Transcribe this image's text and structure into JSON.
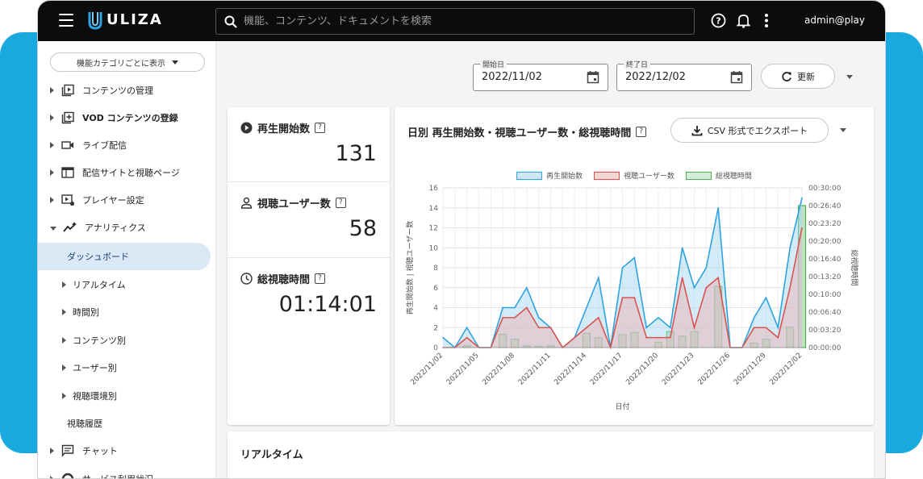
{
  "topbar": {
    "logo_text": "ULIZA",
    "search_placeholder": "機能、コンテンツ、ドキュメントを検索",
    "user": "admin@play"
  },
  "sidebar": {
    "category_select": "機能カテゴリごとに表示",
    "items": [
      {
        "label": "コンテンツの管理",
        "icon": "video-library-icon"
      },
      {
        "label": "VOD コンテンツの登録",
        "icon": "add-box-icon"
      },
      {
        "label": "ライブ配信",
        "icon": "videocam-icon"
      },
      {
        "label": "配信サイトと視聴ページ",
        "icon": "web-icon"
      },
      {
        "label": "プレイヤー設定",
        "icon": "player-settings-icon"
      },
      {
        "label": "アナリティクス",
        "icon": "analytics-icon"
      }
    ],
    "sub_items": [
      {
        "label": "ダッシュボード"
      },
      {
        "label": "リアルタイム"
      },
      {
        "label": "時間別"
      },
      {
        "label": "コンテンツ別"
      },
      {
        "label": "ユーザー別"
      },
      {
        "label": "視聴環境別"
      },
      {
        "label": "視聴履歴"
      }
    ],
    "chat_label": "チャット",
    "service_label": "サービス利用状況"
  },
  "filters": {
    "start_label": "開始日",
    "start_value": "2022/11/02",
    "end_label": "終了日",
    "end_value": "2022/12/02",
    "refresh_label": "更新"
  },
  "stats": [
    {
      "title": "再生開始数",
      "value": "131",
      "icon": "play-circle-icon"
    },
    {
      "title": "視聴ユーザー数",
      "value": "58",
      "icon": "person-icon"
    },
    {
      "title": "総視聴時間",
      "value": "01:14:01",
      "icon": "clock-icon"
    }
  ],
  "chart_panel": {
    "title": "日別 再生開始数・視聴ユーザー数・総視聴時間",
    "export_label": "CSV 形式でエクスポート",
    "export_prefix": "CSV",
    "export_suffix": "形式でエクスポート"
  },
  "colors": {
    "plays": "#2ea3e0",
    "users": "#d9534f",
    "time": "#4caf50"
  },
  "chart_data": {
    "type": "line",
    "title": "",
    "xlabel": "日付",
    "ylabel_left": "再生開始数 | 視聴ユーザー数",
    "ylabel_right": "総視聴時間",
    "ylim": [
      0,
      16
    ],
    "y_ticks": [
      0,
      2,
      4,
      6,
      8,
      10,
      12,
      14,
      16
    ],
    "y2_ticks": [
      "00:00:00",
      "00:03:20",
      "00:06:40",
      "00:10:00",
      "00:13:20",
      "00:16:40",
      "00:20:00",
      "00:23:20",
      "00:26:40",
      "00:30:00"
    ],
    "y2_lim_seconds": [
      0,
      1800
    ],
    "x_tick_labels": [
      "2022/11/02",
      "2022/11/05",
      "2022/11/08",
      "2022/11/11",
      "2022/11/14",
      "2022/11/17",
      "2022/11/20",
      "2022/11/23",
      "2022/11/26",
      "2022/11/29",
      "2022/12/02"
    ],
    "x": [
      "2022/11/02",
      "2022/11/03",
      "2022/11/04",
      "2022/11/05",
      "2022/11/06",
      "2022/11/07",
      "2022/11/08",
      "2022/11/09",
      "2022/11/10",
      "2022/11/11",
      "2022/11/12",
      "2022/11/13",
      "2022/11/14",
      "2022/11/15",
      "2022/11/16",
      "2022/11/17",
      "2022/11/18",
      "2022/11/19",
      "2022/11/20",
      "2022/11/21",
      "2022/11/22",
      "2022/11/23",
      "2022/11/24",
      "2022/11/25",
      "2022/11/26",
      "2022/11/27",
      "2022/11/28",
      "2022/11/29",
      "2022/11/30",
      "2022/12/01",
      "2022/12/02"
    ],
    "series": [
      {
        "name": "再生開始数",
        "kind": "area",
        "axis": "left",
        "values": [
          1,
          0,
          2,
          0,
          0,
          4,
          4,
          6,
          3,
          2,
          0,
          1,
          4,
          7,
          0,
          8,
          9,
          2,
          3,
          2,
          10,
          6,
          8,
          14,
          0,
          0,
          3,
          5,
          2,
          10,
          15
        ]
      },
      {
        "name": "視聴ユーザー数",
        "kind": "area",
        "axis": "left",
        "values": [
          0,
          0,
          1,
          0,
          0,
          3,
          3,
          4,
          2,
          2,
          0,
          1,
          2,
          3,
          0,
          5,
          5,
          1,
          1,
          1,
          7,
          2,
          6,
          7,
          0,
          0,
          2,
          2,
          1,
          6,
          12
        ]
      },
      {
        "name": "総視聴時間",
        "kind": "bar",
        "axis": "right",
        "values": [
          0,
          0,
          20,
          0,
          0,
          150,
          95,
          20,
          15,
          20,
          0,
          0,
          160,
          110,
          0,
          145,
          170,
          0,
          60,
          180,
          130,
          180,
          0,
          690,
          0,
          0,
          50,
          95,
          0,
          230,
          1600
        ]
      }
    ]
  },
  "realtime": {
    "title": "リアルタイム"
  }
}
